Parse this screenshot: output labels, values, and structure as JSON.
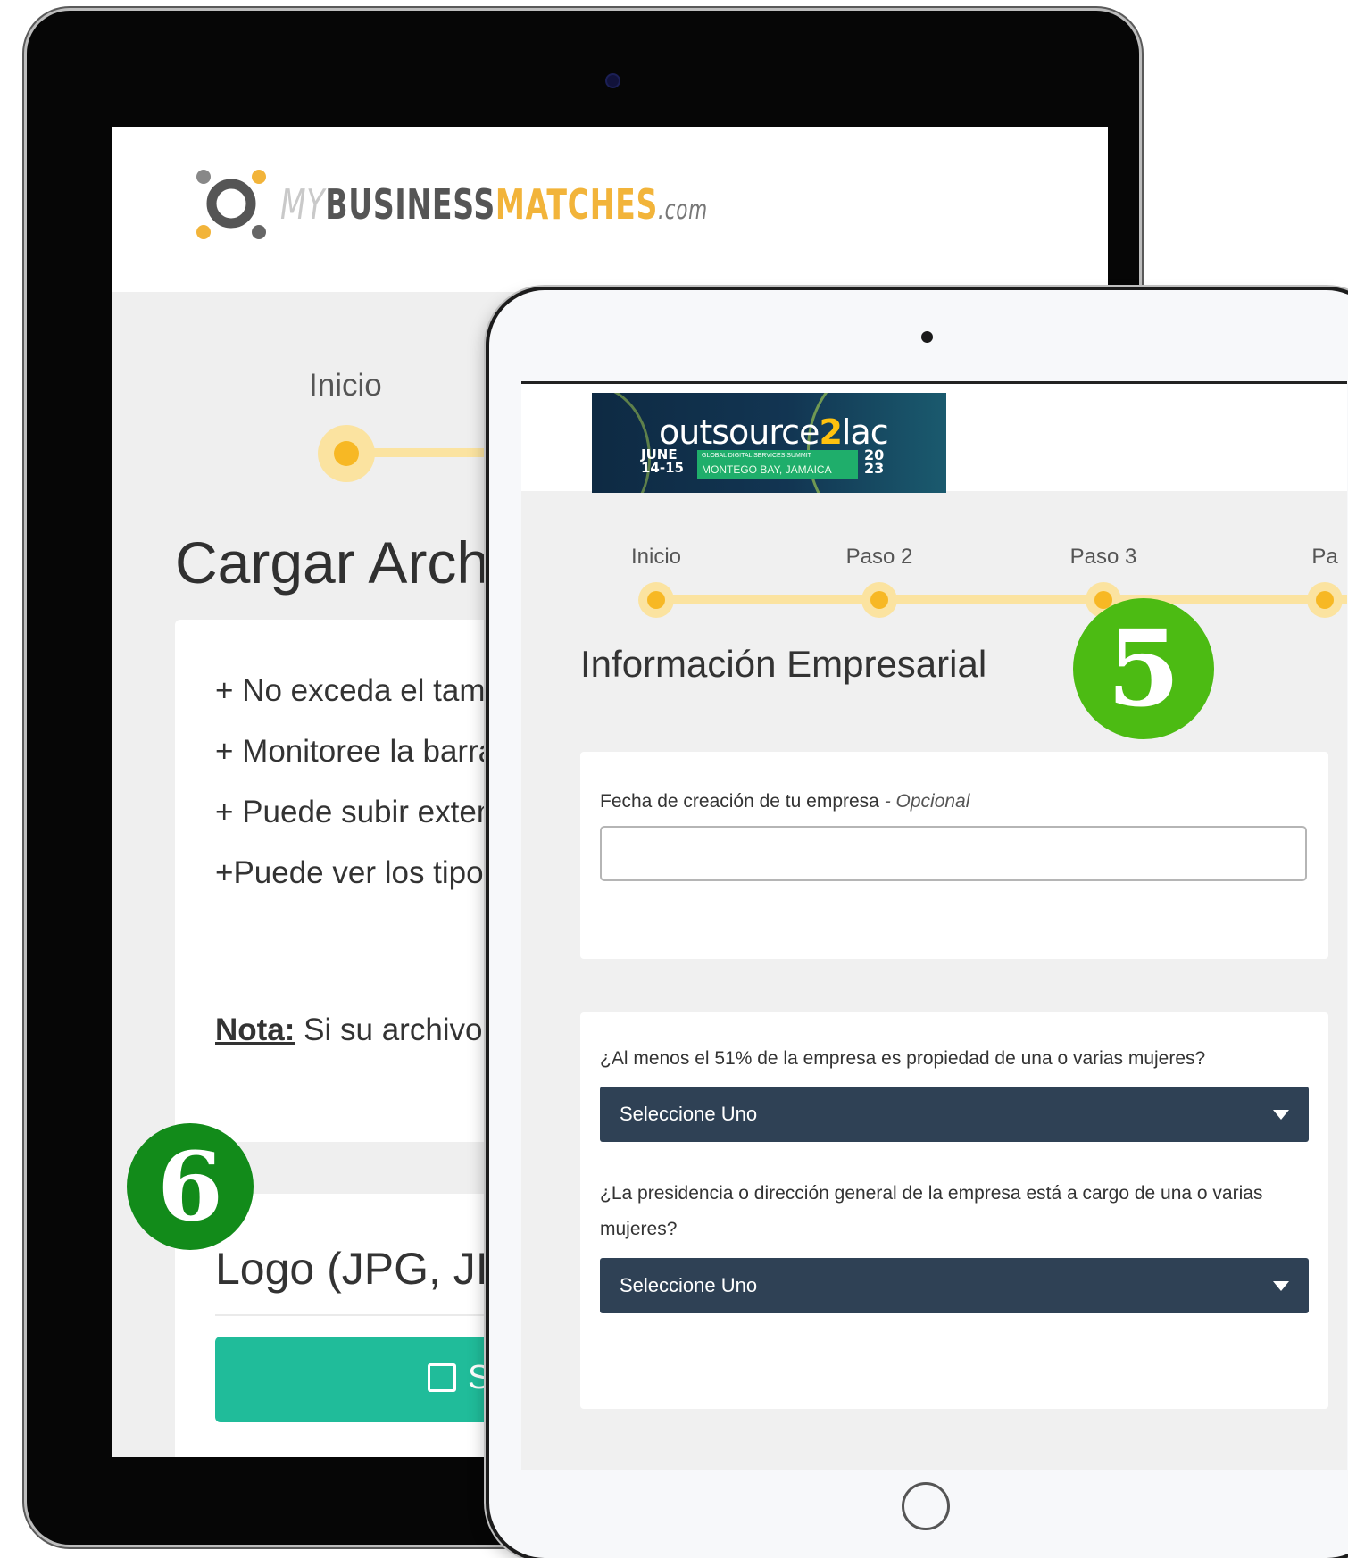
{
  "back_tablet": {
    "logo": {
      "my": "MY",
      "business": "BUSINESS",
      "matches": "MATCHES",
      "com": ".com"
    },
    "step_label": "Inicio",
    "title": "Cargar Archi",
    "instructions": [
      "+ No exceda el tamañ",
      "+ Monitoree la barra d",
      "+ Puede subir extensi",
      "+Puede ver los tipos c"
    ],
    "note_label": "Nota:",
    "note_text": " Si su archivo so",
    "logo_section_title": "Logo (JPG, JI",
    "upload_button_label": "Su"
  },
  "front_tablet": {
    "event_logo": {
      "name_part1": "outsource",
      "name_part2": "2",
      "name_part3": "lac",
      "dates": "JUNE\n14-15",
      "tagline": "GLOBAL DIGITAL SERVICES SUMMIT",
      "location": "MONTEGO BAY, JAMAICA",
      "year": "20\n23"
    },
    "steps": [
      "Inicio",
      "Paso 2",
      "Paso 3",
      "Pa"
    ],
    "title": "Información Empresarial",
    "field_founding_date": {
      "label": "Fecha de creación de tu empresa",
      "optional": " - Opcional",
      "value": ""
    },
    "question_women_owned": {
      "label": "¿Al menos el 51% de la empresa es propiedad de una o varias mujeres?",
      "selected": "Seleccione Uno"
    },
    "question_women_led": {
      "label": "¿La presidencia o dirección general de la empresa está a cargo de una o varias mujeres?",
      "selected": "Seleccione Uno"
    }
  },
  "badges": {
    "front": "5",
    "back": "6"
  },
  "colors": {
    "accent_yellow": "#f7b824",
    "step_track": "#fbe3a0",
    "select_bg": "#2f4155",
    "upload_green": "#20bc9a",
    "badge_green_light": "#4cbb13",
    "badge_green_dark": "#128b1a"
  }
}
